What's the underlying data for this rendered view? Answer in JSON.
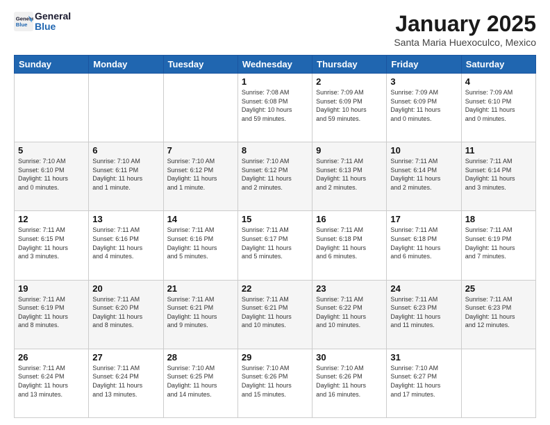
{
  "header": {
    "logo_line1": "General",
    "logo_line2": "Blue",
    "title": "January 2025",
    "subtitle": "Santa Maria Huexoculco, Mexico"
  },
  "days_of_week": [
    "Sunday",
    "Monday",
    "Tuesday",
    "Wednesday",
    "Thursday",
    "Friday",
    "Saturday"
  ],
  "weeks": [
    [
      {
        "day": "",
        "info": ""
      },
      {
        "day": "",
        "info": ""
      },
      {
        "day": "",
        "info": ""
      },
      {
        "day": "1",
        "info": "Sunrise: 7:08 AM\nSunset: 6:08 PM\nDaylight: 10 hours\nand 59 minutes."
      },
      {
        "day": "2",
        "info": "Sunrise: 7:09 AM\nSunset: 6:09 PM\nDaylight: 10 hours\nand 59 minutes."
      },
      {
        "day": "3",
        "info": "Sunrise: 7:09 AM\nSunset: 6:09 PM\nDaylight: 11 hours\nand 0 minutes."
      },
      {
        "day": "4",
        "info": "Sunrise: 7:09 AM\nSunset: 6:10 PM\nDaylight: 11 hours\nand 0 minutes."
      }
    ],
    [
      {
        "day": "5",
        "info": "Sunrise: 7:10 AM\nSunset: 6:10 PM\nDaylight: 11 hours\nand 0 minutes."
      },
      {
        "day": "6",
        "info": "Sunrise: 7:10 AM\nSunset: 6:11 PM\nDaylight: 11 hours\nand 1 minute."
      },
      {
        "day": "7",
        "info": "Sunrise: 7:10 AM\nSunset: 6:12 PM\nDaylight: 11 hours\nand 1 minute."
      },
      {
        "day": "8",
        "info": "Sunrise: 7:10 AM\nSunset: 6:12 PM\nDaylight: 11 hours\nand 2 minutes."
      },
      {
        "day": "9",
        "info": "Sunrise: 7:11 AM\nSunset: 6:13 PM\nDaylight: 11 hours\nand 2 minutes."
      },
      {
        "day": "10",
        "info": "Sunrise: 7:11 AM\nSunset: 6:14 PM\nDaylight: 11 hours\nand 2 minutes."
      },
      {
        "day": "11",
        "info": "Sunrise: 7:11 AM\nSunset: 6:14 PM\nDaylight: 11 hours\nand 3 minutes."
      }
    ],
    [
      {
        "day": "12",
        "info": "Sunrise: 7:11 AM\nSunset: 6:15 PM\nDaylight: 11 hours\nand 3 minutes."
      },
      {
        "day": "13",
        "info": "Sunrise: 7:11 AM\nSunset: 6:16 PM\nDaylight: 11 hours\nand 4 minutes."
      },
      {
        "day": "14",
        "info": "Sunrise: 7:11 AM\nSunset: 6:16 PM\nDaylight: 11 hours\nand 5 minutes."
      },
      {
        "day": "15",
        "info": "Sunrise: 7:11 AM\nSunset: 6:17 PM\nDaylight: 11 hours\nand 5 minutes."
      },
      {
        "day": "16",
        "info": "Sunrise: 7:11 AM\nSunset: 6:18 PM\nDaylight: 11 hours\nand 6 minutes."
      },
      {
        "day": "17",
        "info": "Sunrise: 7:11 AM\nSunset: 6:18 PM\nDaylight: 11 hours\nand 6 minutes."
      },
      {
        "day": "18",
        "info": "Sunrise: 7:11 AM\nSunset: 6:19 PM\nDaylight: 11 hours\nand 7 minutes."
      }
    ],
    [
      {
        "day": "19",
        "info": "Sunrise: 7:11 AM\nSunset: 6:19 PM\nDaylight: 11 hours\nand 8 minutes."
      },
      {
        "day": "20",
        "info": "Sunrise: 7:11 AM\nSunset: 6:20 PM\nDaylight: 11 hours\nand 8 minutes."
      },
      {
        "day": "21",
        "info": "Sunrise: 7:11 AM\nSunset: 6:21 PM\nDaylight: 11 hours\nand 9 minutes."
      },
      {
        "day": "22",
        "info": "Sunrise: 7:11 AM\nSunset: 6:21 PM\nDaylight: 11 hours\nand 10 minutes."
      },
      {
        "day": "23",
        "info": "Sunrise: 7:11 AM\nSunset: 6:22 PM\nDaylight: 11 hours\nand 10 minutes."
      },
      {
        "day": "24",
        "info": "Sunrise: 7:11 AM\nSunset: 6:23 PM\nDaylight: 11 hours\nand 11 minutes."
      },
      {
        "day": "25",
        "info": "Sunrise: 7:11 AM\nSunset: 6:23 PM\nDaylight: 11 hours\nand 12 minutes."
      }
    ],
    [
      {
        "day": "26",
        "info": "Sunrise: 7:11 AM\nSunset: 6:24 PM\nDaylight: 11 hours\nand 13 minutes."
      },
      {
        "day": "27",
        "info": "Sunrise: 7:11 AM\nSunset: 6:24 PM\nDaylight: 11 hours\nand 13 minutes."
      },
      {
        "day": "28",
        "info": "Sunrise: 7:10 AM\nSunset: 6:25 PM\nDaylight: 11 hours\nand 14 minutes."
      },
      {
        "day": "29",
        "info": "Sunrise: 7:10 AM\nSunset: 6:26 PM\nDaylight: 11 hours\nand 15 minutes."
      },
      {
        "day": "30",
        "info": "Sunrise: 7:10 AM\nSunset: 6:26 PM\nDaylight: 11 hours\nand 16 minutes."
      },
      {
        "day": "31",
        "info": "Sunrise: 7:10 AM\nSunset: 6:27 PM\nDaylight: 11 hours\nand 17 minutes."
      },
      {
        "day": "",
        "info": ""
      }
    ]
  ]
}
